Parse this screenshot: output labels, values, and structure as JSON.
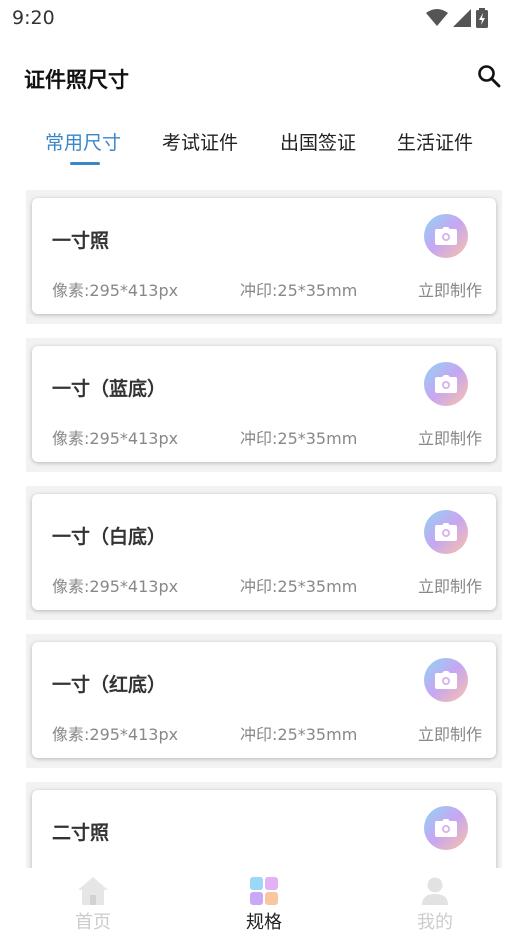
{
  "status_bar": {
    "time": "9:20",
    "icons": [
      "wifi-icon",
      "signal-icon",
      "battery-icon"
    ]
  },
  "header": {
    "title": "证件照尺寸",
    "search_icon": "search-icon"
  },
  "tabs": [
    {
      "label": "常用尺寸",
      "active": true
    },
    {
      "label": "考试证件",
      "active": false
    },
    {
      "label": "出国签证",
      "active": false
    },
    {
      "label": "生活证件",
      "active": false
    }
  ],
  "cards": [
    {
      "title": "一寸照",
      "pixel": "像素:295*413px",
      "print": "冲印:25*35mm",
      "action": "立即制作"
    },
    {
      "title": "一寸（蓝底）",
      "pixel": "像素:295*413px",
      "print": "冲印:25*35mm",
      "action": "立即制作"
    },
    {
      "title": "一寸（白底）",
      "pixel": "像素:295*413px",
      "print": "冲印:25*35mm",
      "action": "立即制作"
    },
    {
      "title": "一寸（红底）",
      "pixel": "像素:295*413px",
      "print": "冲印:25*35mm",
      "action": "立即制作"
    },
    {
      "title": "二寸照",
      "pixel": "",
      "print": "",
      "action": ""
    }
  ],
  "bottom_nav": [
    {
      "label": "首页",
      "icon": "home-icon",
      "active": false
    },
    {
      "label": "规格",
      "icon": "grid-icon",
      "active": true
    },
    {
      "label": "我的",
      "icon": "user-icon",
      "active": false
    }
  ],
  "colors": {
    "accent": "#3a86c8",
    "inactive_nav": "#cccccc"
  }
}
